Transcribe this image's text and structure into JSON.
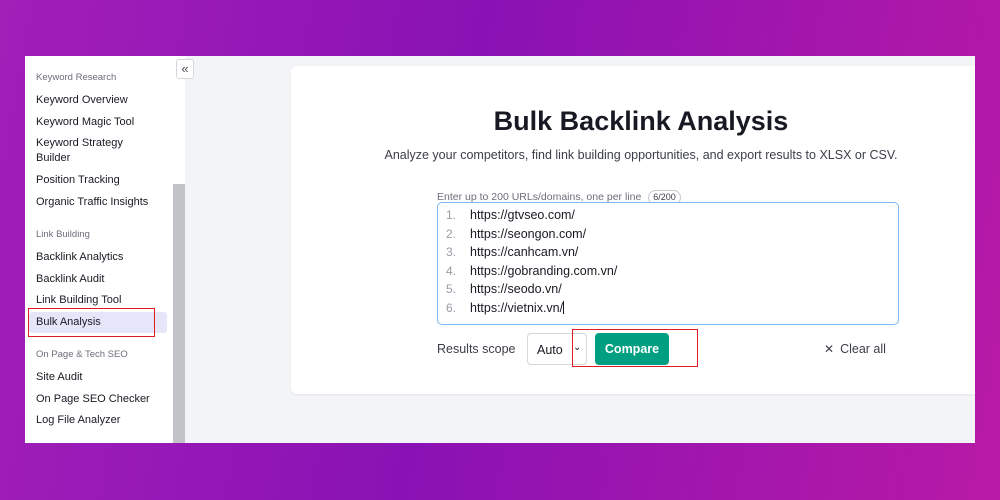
{
  "sidebar": {
    "collapse_icon": "«",
    "sections": [
      {
        "title": "Keyword Research",
        "items": [
          "Keyword Overview",
          "Keyword Magic Tool",
          "Keyword Strategy Builder",
          "Position Tracking",
          "Organic Traffic Insights"
        ]
      },
      {
        "title": "Link Building",
        "items": [
          "Backlink Analytics",
          "Backlink Audit",
          "Link Building Tool",
          "Bulk Analysis"
        ]
      },
      {
        "title": "On Page & Tech SEO",
        "items": [
          "Site Audit",
          "On Page SEO Checker",
          "Log File Analyzer"
        ]
      }
    ],
    "active_item": "Bulk Analysis"
  },
  "main": {
    "title": "Bulk Backlink Analysis",
    "subtitle": "Analyze your competitors, find link building opportunities, and export results to XLSX or CSV.",
    "input_label": "Enter up to 200 URLs/domains, one per line",
    "counter": "6/200",
    "urls": [
      {
        "num": "1.",
        "url": "https://gtvseo.com/"
      },
      {
        "num": "2.",
        "url": "https://seongon.com/"
      },
      {
        "num": "3.",
        "url": "https://canhcam.vn/"
      },
      {
        "num": "4.",
        "url": "https://gobranding.com.vn/"
      },
      {
        "num": "5.",
        "url": "https://seodo.vn/"
      },
      {
        "num": "6.",
        "url": "https://vietnix.vn/"
      }
    ],
    "results_scope_label": "Results scope",
    "scope_value": "Auto",
    "scope_chevron": "⌄",
    "compare_label": "Compare",
    "clear_icon": "✕",
    "clear_label": "Clear all"
  },
  "colors": {
    "accent_green": "#009f81",
    "highlight_red": "#e01b24",
    "active_bg": "#e6e6fb",
    "focus_border": "#7fb8f0"
  }
}
